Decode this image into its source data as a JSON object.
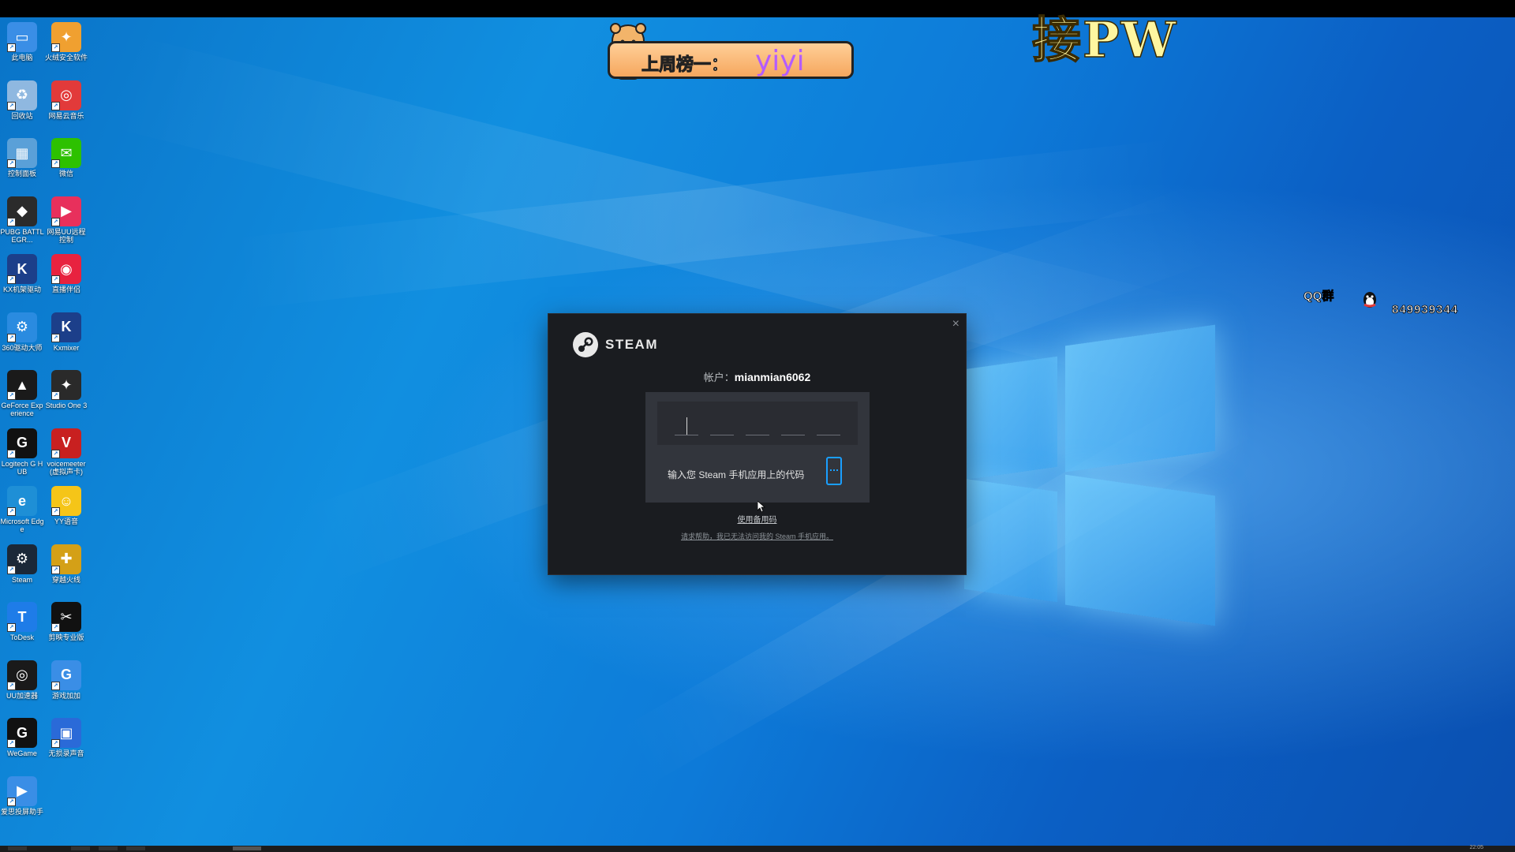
{
  "desktop_icons": [
    {
      "label": "此电脑",
      "icon": "this-pc-icon",
      "color": "#3a8ee6",
      "glyph": "▭"
    },
    {
      "label": "火绒安全软件",
      "icon": "huorong-icon",
      "color": "#f0a030",
      "glyph": "✦"
    },
    {
      "label": "回收站",
      "icon": "recycle-bin-icon",
      "color": "#8fb8e0",
      "glyph": "♻"
    },
    {
      "label": "网易云音乐",
      "icon": "netease-music-icon",
      "color": "#e23a3a",
      "glyph": "◎"
    },
    {
      "label": "控制面板",
      "icon": "control-panel-icon",
      "color": "#5aa0d8",
      "glyph": "▦"
    },
    {
      "label": "微信",
      "icon": "wechat-icon",
      "color": "#2dc100",
      "glyph": "✉"
    },
    {
      "label": "PUBG BATTLEGR...",
      "icon": "pubg-icon",
      "color": "#2b2b2b",
      "glyph": "◆"
    },
    {
      "label": "网易UU远程控制",
      "icon": "uu-remote-icon",
      "color": "#e8305c",
      "glyph": "▶"
    },
    {
      "label": "KX机架驱动",
      "icon": "kx-driver-icon",
      "color": "#1c3f8a",
      "glyph": "K"
    },
    {
      "label": "直播伴侣",
      "icon": "live-companion-icon",
      "color": "#e8223f",
      "glyph": "◉"
    },
    {
      "label": "360驱动大师",
      "icon": "360-driver-icon",
      "color": "#2a8be0",
      "glyph": "⚙"
    },
    {
      "label": "Kxmixer",
      "icon": "kxmixer-icon",
      "color": "#1c3f8a",
      "glyph": "K"
    },
    {
      "label": "GeForce Experience",
      "icon": "geforce-icon",
      "color": "#1a1a1a",
      "glyph": "▲"
    },
    {
      "label": "Studio One 3",
      "icon": "studio-one-icon",
      "color": "#2a2a2a",
      "glyph": "✦"
    },
    {
      "label": "Logitech G HUB",
      "icon": "logitech-ghub-icon",
      "color": "#111111",
      "glyph": "G"
    },
    {
      "label": "voicemeeter(虚拟声卡)",
      "icon": "voicemeeter-icon",
      "color": "#c82020",
      "glyph": "V"
    },
    {
      "label": "Microsoft Edge",
      "icon": "edge-icon",
      "color": "#1e8fd6",
      "glyph": "e"
    },
    {
      "label": "YY语音",
      "icon": "yy-icon",
      "color": "#f5c518",
      "glyph": "☺"
    },
    {
      "label": "Steam",
      "icon": "steam-icon",
      "color": "#1b2838",
      "glyph": "⚙"
    },
    {
      "label": "穿越火线",
      "icon": "crossfire-icon",
      "color": "#d4a017",
      "glyph": "✚"
    },
    {
      "label": "ToDesk",
      "icon": "todesk-icon",
      "color": "#1e7ce8",
      "glyph": "T"
    },
    {
      "label": "剪映专业版",
      "icon": "capcut-icon",
      "color": "#111111",
      "glyph": "✂"
    },
    {
      "label": "UU加速器",
      "icon": "uu-booster-icon",
      "color": "#1a1a1a",
      "glyph": "◎"
    },
    {
      "label": "游戏加加",
      "icon": "game-plus-icon",
      "color": "#3a8ee6",
      "glyph": "G"
    },
    {
      "label": "WeGame",
      "icon": "wegame-icon",
      "color": "#111111",
      "glyph": "G"
    },
    {
      "label": "无损录声音",
      "icon": "audio-record-icon",
      "color": "#2a6ad8",
      "glyph": "▣"
    },
    {
      "label": "爱思投屏助手",
      "icon": "aisi-mirror-icon",
      "color": "#3a8ee6",
      "glyph": "▶"
    }
  ],
  "overlay": {
    "banner_label": "上周榜一：",
    "banner_name": "yiyi",
    "pw_text": "接PW",
    "qq_label": "QQ群",
    "qq_number": "849939344"
  },
  "steam_dialog": {
    "close": "×",
    "brand": "STEAM",
    "account_label": "帐户：",
    "account_name": "mianmian6062",
    "instruction": "输入您 Steam 手机应用上的代码",
    "backup_link": "使用备用码",
    "help_link": "请求帮助，我已无法访问我的 Steam 手机应用。",
    "accent_color": "#1a9fff"
  },
  "taskbar": {
    "clock": "22:05"
  }
}
